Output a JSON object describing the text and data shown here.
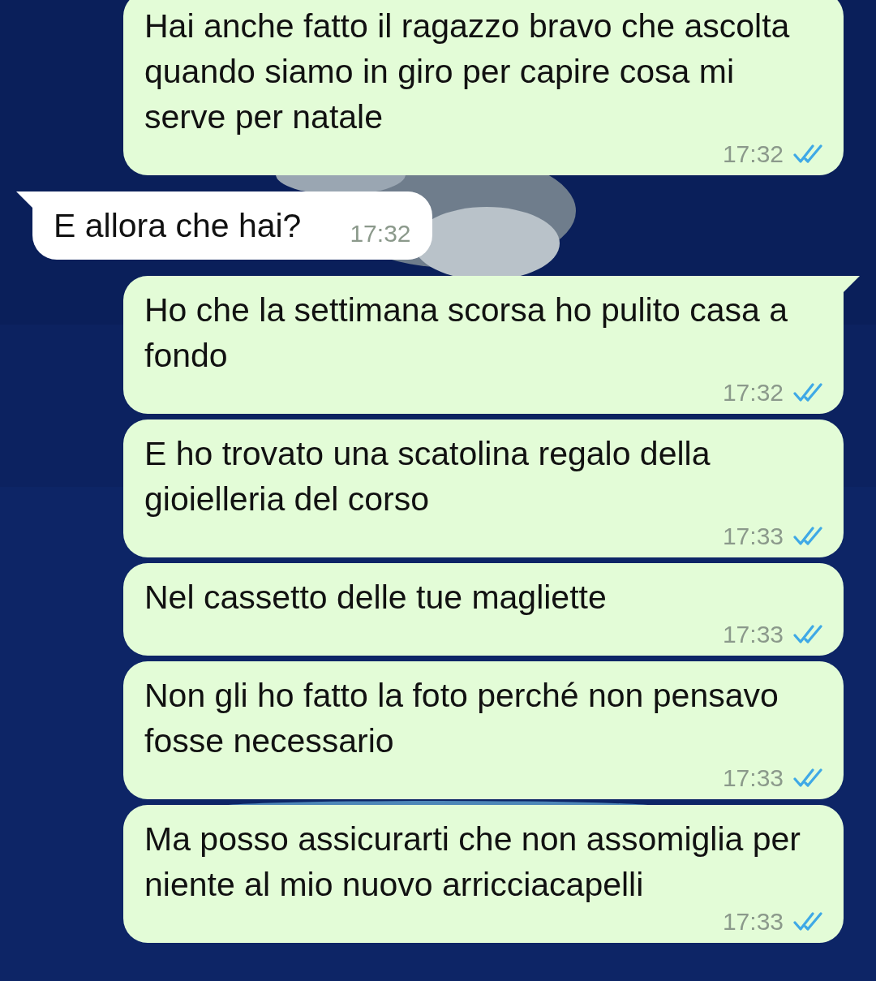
{
  "messages": [
    {
      "kind": "outgoing",
      "text": "Hai anche fatto il ragazzo bravo che ascolta quando siamo in giro per capire cosa mi serve per natale",
      "time": "17:32",
      "read": true
    },
    {
      "kind": "incoming",
      "text": "E allora che hai?",
      "time": "17:32"
    },
    {
      "kind": "outgoing",
      "text": "Ho che la settimana scorsa ho pulito casa a fondo",
      "time": "17:32",
      "read": true
    },
    {
      "kind": "outgoing",
      "text": "E ho trovato una scatolina regalo della gioielleria del corso",
      "time": "17:33",
      "read": true
    },
    {
      "kind": "outgoing",
      "text": "Nel cassetto delle tue magliette",
      "time": "17:33",
      "read": true
    },
    {
      "kind": "outgoing",
      "text": "Non gli ho fatto la foto perché non pensavo fosse necessario",
      "time": "17:33",
      "read": true
    },
    {
      "kind": "outgoing",
      "text": "Ma posso assicurarti che non assomiglia per niente al mio nuovo arricciacapelli",
      "time": "17:33",
      "read": true
    }
  ]
}
